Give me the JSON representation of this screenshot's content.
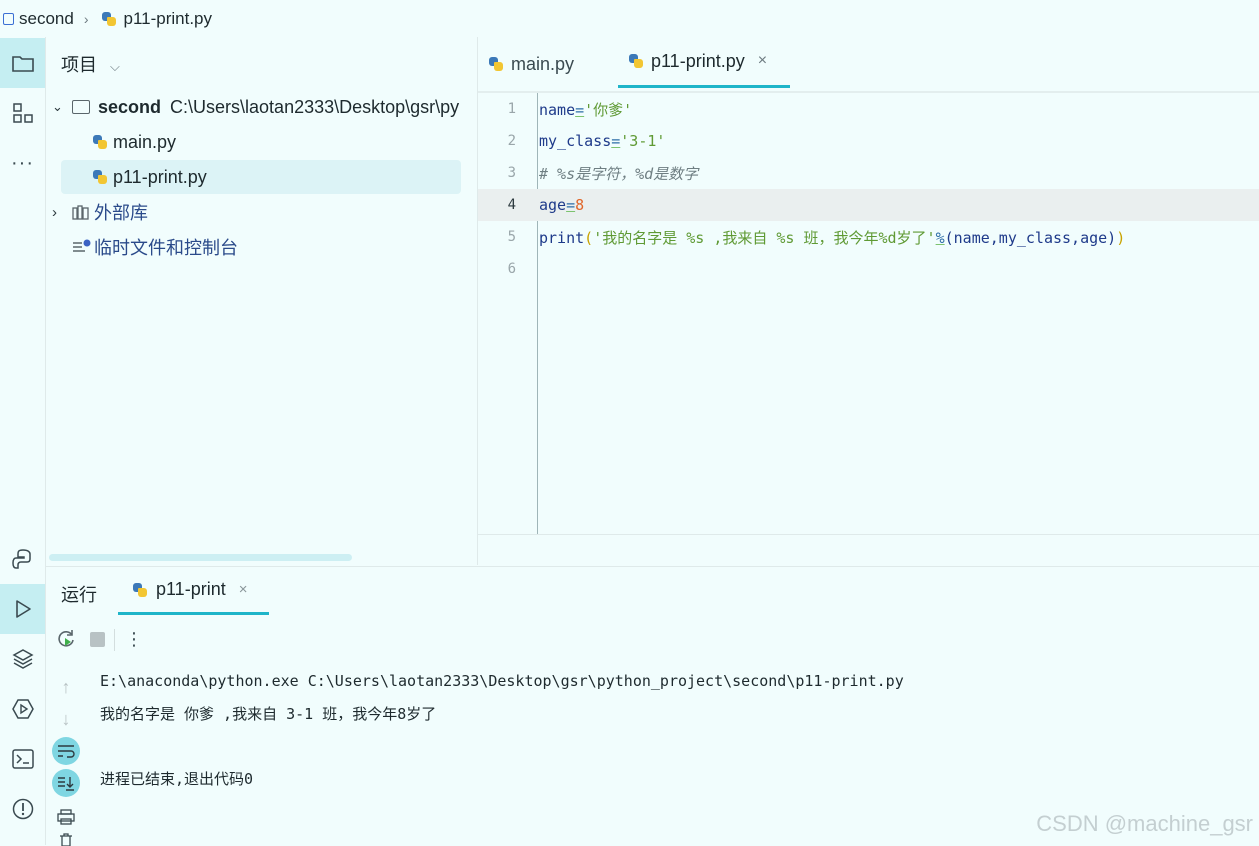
{
  "breadcrumb": {
    "project": "second",
    "file": "p11-print.py"
  },
  "project_panel": {
    "title": "项目",
    "root": {
      "name": "second",
      "path": "C:\\Users\\laotan2333\\Desktop\\gsr\\py"
    },
    "files": [
      "main.py",
      "p11-print.py"
    ],
    "external_libs": "外部库",
    "scratches": "临时文件和控制台"
  },
  "editor": {
    "tabs": [
      {
        "label": "main.py"
      },
      {
        "label": "p11-print.py"
      }
    ],
    "line_numbers": [
      "1",
      "2",
      "3",
      "4",
      "5",
      "6"
    ],
    "code": {
      "l1": {
        "var": "name",
        "op": "=",
        "str": "'你爹'"
      },
      "l2": {
        "var": "my_class",
        "op": "=",
        "str": "'3-1'"
      },
      "l3": {
        "comment": "# %s是字符，%d是数字"
      },
      "l4": {
        "var": "age",
        "op": "=",
        "num": "8"
      },
      "l5": {
        "fn": "print",
        "open": "(",
        "str": "'我的名字是 %s ,我来自 %s 班，我今年%d岁了'",
        "op": "%",
        "args": "(name,my_class,age)",
        "close": ")"
      }
    }
  },
  "run_panel": {
    "title": "运行",
    "tab_label": "p11-print",
    "console": [
      "E:\\anaconda\\python.exe C:\\Users\\laotan2333\\Desktop\\gsr\\python_project\\second\\p11-print.py",
      "我的名字是 你爹 ,我来自 3-1 班，我今年8岁了",
      "",
      "进程已结束,退出代码0"
    ]
  },
  "watermark": "CSDN @machine_gsr",
  "colors": {
    "accent": "#1fb5c9",
    "background": "#f1fdfd",
    "string": "#5f9a34",
    "number": "#e0662a"
  }
}
